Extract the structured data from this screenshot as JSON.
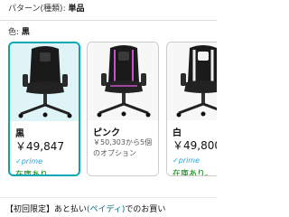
{
  "pattern": {
    "label": "パターン(種類):",
    "value": "単品"
  },
  "color": {
    "label": "色:",
    "value": "黒"
  },
  "variants": [
    {
      "name": "黒",
      "price": "￥49,847",
      "prime": "prime",
      "stock": "在庫あり。",
      "selected": true
    },
    {
      "name": "ピンク",
      "offers": "￥50,303から5個のオプション",
      "selected": false
    },
    {
      "name": "白",
      "price": "￥49,800",
      "prime": "prime",
      "stock": "在庫あり。",
      "selected": false
    }
  ],
  "promo": {
    "prefix": "【初回限定】あと払い",
    "highlight": "(ペイディ)",
    "suffix": "でのお買い"
  },
  "colors": {
    "selected_border": "#00a8b5",
    "in_stock": "#007600",
    "prime": "#1fa6e0",
    "link": "#007185"
  }
}
